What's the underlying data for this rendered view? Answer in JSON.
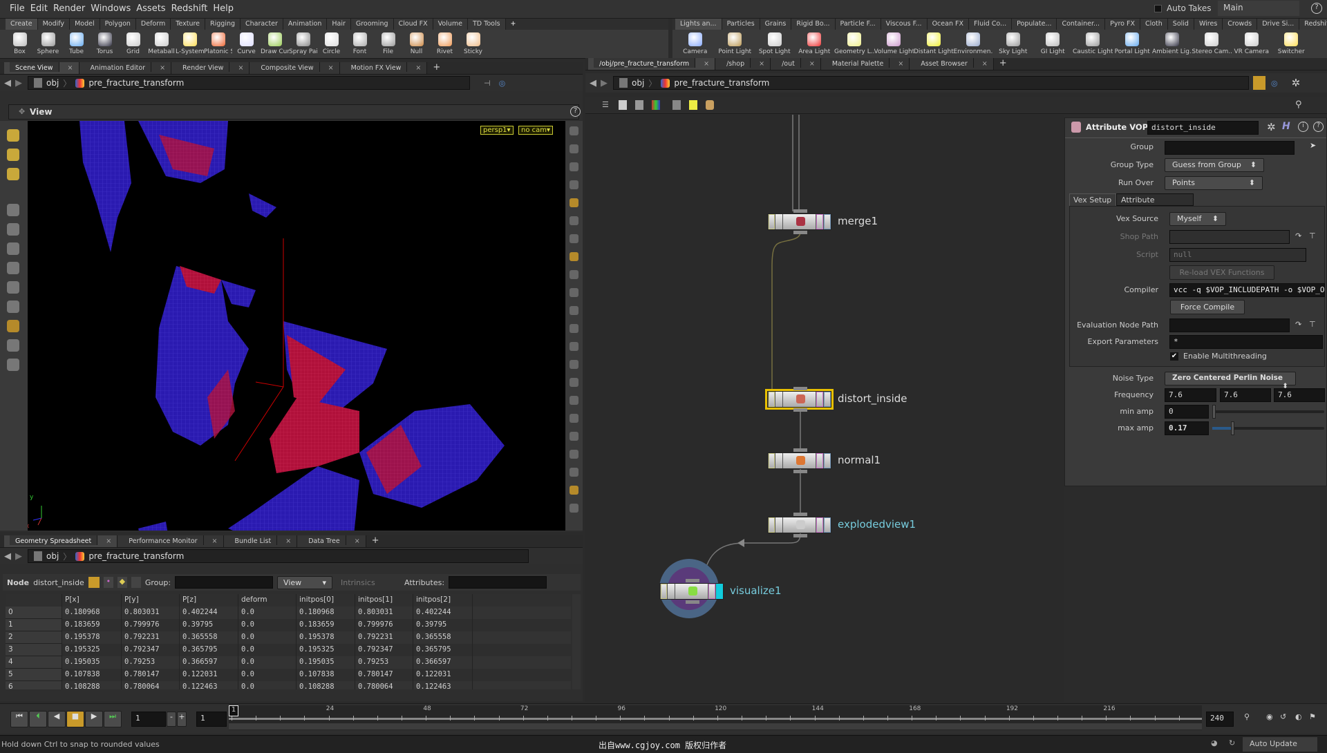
{
  "menu": [
    "File",
    "Edit",
    "Render",
    "Windows",
    "Assets",
    "Redshift",
    "Help"
  ],
  "takes": {
    "auto_takes": "Auto Takes",
    "take": "Main"
  },
  "shelf_left": {
    "tabs": [
      "Create",
      "Modify",
      "Model",
      "Polygon",
      "Deform",
      "Texture",
      "Rigging",
      "Character",
      "Animation",
      "Hair",
      "Grooming",
      "Cloud FX",
      "Volume",
      "TD Tools"
    ],
    "tools": [
      "Box",
      "Sphere",
      "Tube",
      "Torus",
      "Grid",
      "Metaball",
      "L-System",
      "Platonic Sol...",
      "Curve",
      "Draw Curve",
      "Spray Paint",
      "Circle",
      "Font",
      "File",
      "Null",
      "Rivet",
      "Sticky"
    ]
  },
  "shelf_right": {
    "tabs": [
      "Lights an...",
      "Particles",
      "Grains",
      "Rigid Bo...",
      "Particle F...",
      "Viscous F...",
      "Ocean FX",
      "Fluid Co...",
      "Populate...",
      "Container...",
      "Pyro FX",
      "Cloth",
      "Solid",
      "Wires",
      "Crowds",
      "Drive Si...",
      "Redshift"
    ],
    "tools": [
      "Camera",
      "Point Light",
      "Spot Light",
      "Area Light",
      "Geometry L...",
      "Volume Light",
      "Distant Light",
      "Environmen...",
      "Sky Light",
      "GI Light",
      "Caustic Light",
      "Portal Light",
      "Ambient Lig...",
      "Stereo Cam...",
      "VR Camera",
      "Switcher"
    ]
  },
  "viewer": {
    "tabs": [
      "Scene View",
      "Animation Editor",
      "Render View",
      "Composite View",
      "Motion FX View"
    ],
    "path_root": "obj",
    "path_node": "pre_fracture_transform",
    "title": "View",
    "camera": "persp1",
    "cam_menu": "no cam",
    "axis_x": "x",
    "axis_y": "y",
    "axis_z": "z"
  },
  "network": {
    "tabs": [
      "/obj/pre_fracture_transform",
      "/shop",
      "/out",
      "Material Palette",
      "Asset Browser"
    ],
    "path_root": "obj",
    "path_node": "pre_fracture_transform",
    "nodes": [
      "merge1",
      "distort_inside",
      "normal1",
      "explodedview1",
      "visualize1"
    ]
  },
  "params": {
    "type": "Attribute VOP",
    "name": "distort_inside",
    "group_label": "Group",
    "group": "",
    "group_type_label": "Group Type",
    "group_type": "Guess from Group",
    "run_over_label": "Run Over",
    "run_over": "Points",
    "tabs": [
      "Vex Setup",
      "Attribute Bindings"
    ],
    "vex_source_label": "Vex Source",
    "vex_source": "Myself",
    "shop_path_label": "Shop Path",
    "script_label": "Script",
    "script": "null",
    "reload": "Re-load VEX Functions",
    "compiler_label": "Compiler",
    "compiler": "vcc -q $VOP_INCLUDEPATH -o $VOP_OB",
    "force_compile": "Force Compile",
    "eval_path_label": "Evaluation Node Path",
    "export_label": "Export Parameters",
    "export": "*",
    "multithread": "Enable Multithreading",
    "multithread_on": true,
    "noise_type_label": "Noise Type",
    "noise_type": "Zero Centered Perlin Noise",
    "frequency_label": "Frequency",
    "frequency": [
      "7.6",
      "7.6",
      "7.6"
    ],
    "min_amp_label": "min amp",
    "min_amp": "0",
    "max_amp_label": "max amp",
    "max_amp": "0.17"
  },
  "spreadsheet": {
    "tabs": [
      "Geometry Spreadsheet",
      "Performance Monitor",
      "Bundle List",
      "Data Tree"
    ],
    "path_root": "obj",
    "path_node": "pre_fracture_transform",
    "node_label": "Node",
    "node": "distort_inside",
    "group_label": "Group:",
    "view": "View",
    "intrinsics": "Intrinsics",
    "attributes_label": "Attributes:",
    "columns": [
      "",
      "P[x]",
      "P[y]",
      "P[z]",
      "deform",
      "initpos[0]",
      "initpos[1]",
      "initpos[2]"
    ],
    "rows": [
      [
        "0",
        "0.180968",
        "0.803031",
        "0.402244",
        "0.0",
        "0.180968",
        "0.803031",
        "0.402244"
      ],
      [
        "1",
        "0.183659",
        "0.799976",
        "0.39795",
        "0.0",
        "0.183659",
        "0.799976",
        "0.39795"
      ],
      [
        "2",
        "0.195378",
        "0.792231",
        "0.365558",
        "0.0",
        "0.195378",
        "0.792231",
        "0.365558"
      ],
      [
        "3",
        "0.195325",
        "0.792347",
        "0.365795",
        "0.0",
        "0.195325",
        "0.792347",
        "0.365795"
      ],
      [
        "4",
        "0.195035",
        "0.79253",
        "0.366597",
        "0.0",
        "0.195035",
        "0.79253",
        "0.366597"
      ],
      [
        "5",
        "0.107838",
        "0.780147",
        "0.122031",
        "0.0",
        "0.107838",
        "0.780147",
        "0.122031"
      ],
      [
        "6",
        "0.108288",
        "0.780064",
        "0.122463",
        "0.0",
        "0.108288",
        "0.780064",
        "0.122463"
      ]
    ]
  },
  "timeline": {
    "frame": "1",
    "start": "1",
    "end": "240",
    "current_marker": "1",
    "ticks": [
      "24",
      "48",
      "72",
      "96",
      "120",
      "144",
      "168",
      "192",
      "216"
    ]
  },
  "status": {
    "message": "Hold down Ctrl to snap to rounded values",
    "watermark": "出自www.cgjoy.com 版权归作者",
    "update_mode": "Auto Update"
  }
}
